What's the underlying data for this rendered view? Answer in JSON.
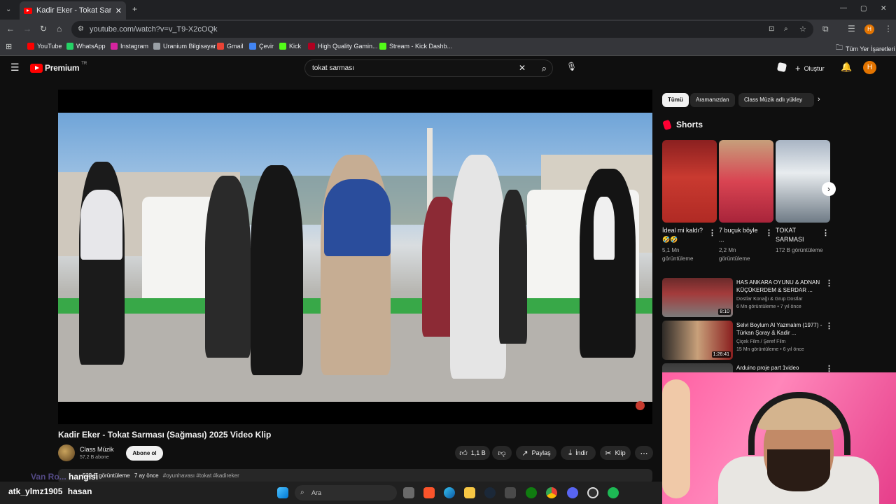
{
  "browser": {
    "tab_title": "Kadir Eker - Tokat Sarması (Sağ",
    "url": "youtube.com/watch?v=v_T9-X2cOQk",
    "bookmarks": [
      {
        "label": "YouTube",
        "color": "#ff0000"
      },
      {
        "label": "WhatsApp",
        "color": "#25d366"
      },
      {
        "label": "Instagram",
        "color": "#d6249f"
      },
      {
        "label": "Uranium Bilgisayar",
        "color": "#9aa0a6"
      },
      {
        "label": "Gmail",
        "color": "#ea4335"
      },
      {
        "label": "Çevir",
        "color": "#4285f4"
      },
      {
        "label": "Kick",
        "color": "#53fc18"
      },
      {
        "label": "High Quality Gamin...",
        "color": "#b00020"
      },
      {
        "label": "Stream - Kick Dashb...",
        "color": "#53fc18"
      }
    ],
    "all_bookmarks": "Tüm Yer İşaretleri",
    "avatar_letter": "H"
  },
  "youtube": {
    "logo": "Premium",
    "logo_region": "TR",
    "search_value": "tokat sarması",
    "create_label": "Oluştur",
    "avatar_letter": "H"
  },
  "video": {
    "title": "Kadir Eker - Tokat Sarması (Sağması) 2025 Video Klip",
    "channel": "Class Müzik",
    "subscribers": "57,2 B abone",
    "subscribe_label": "Abone ol",
    "likes": "1,1 B",
    "share_label": "Paylaş",
    "download_label": "İndir",
    "clip_label": "Klip",
    "desc_age": "7 ay önce",
    "desc_views": "538 B görüntüleme",
    "hashtags": "#oyunhavası #tokat #kadireker"
  },
  "sidebar": {
    "chips": [
      "Tümü",
      "Aramanızdan",
      "Class Müzik adlı yükley"
    ],
    "shorts_heading": "Shorts",
    "shorts": [
      {
        "title": "İdeal mi kaldı? 🤣🤣",
        "views": "5,1 Mn görüntüleme"
      },
      {
        "title": "7 buçuk böyle ...",
        "views": "2,2 Mn görüntüleme"
      },
      {
        "title": "TOKAT SARMASI",
        "views": "172 B görüntüleme"
      }
    ],
    "related": [
      {
        "title": "HAS ANKARA OYUNU & ADNAN KÜÇÜKERDEM & SERDAR ...",
        "channel": "Dostlar Konağı & Grup Dostlar",
        "meta": "6 Mn görüntüleme • 7 yıl önce",
        "duration": "8:10"
      },
      {
        "title": "Selvi Boylum Al Yazmalım (1977) - Türkan Şoray & Kadir ...",
        "channel": "Çiçek Film / Şeref Film",
        "meta": "15 Mn görüntüleme • 6 yıl önce",
        "duration": "1:26:41"
      },
      {
        "title": "Arduino proje part 1video",
        "channel": "",
        "meta": "",
        "duration": ""
      }
    ]
  },
  "overlay": {
    "chat_line1_user": "Van Ro...",
    "chat_line1_text": "hangisi",
    "chat_line2_user": "atk_ylmz1905",
    "chat_line2_text": "hasan"
  },
  "taskbar": {
    "search_placeholder": "Ara",
    "icons": [
      "windows-icon",
      "search-box",
      "task-view-icon",
      "brave-icon",
      "edge-icon",
      "file-explorer-icon",
      "steam-icon",
      "store-icon",
      "xbox-icon",
      "chrome-icon",
      "discord-icon",
      "obs-icon",
      "spotify-icon"
    ]
  }
}
